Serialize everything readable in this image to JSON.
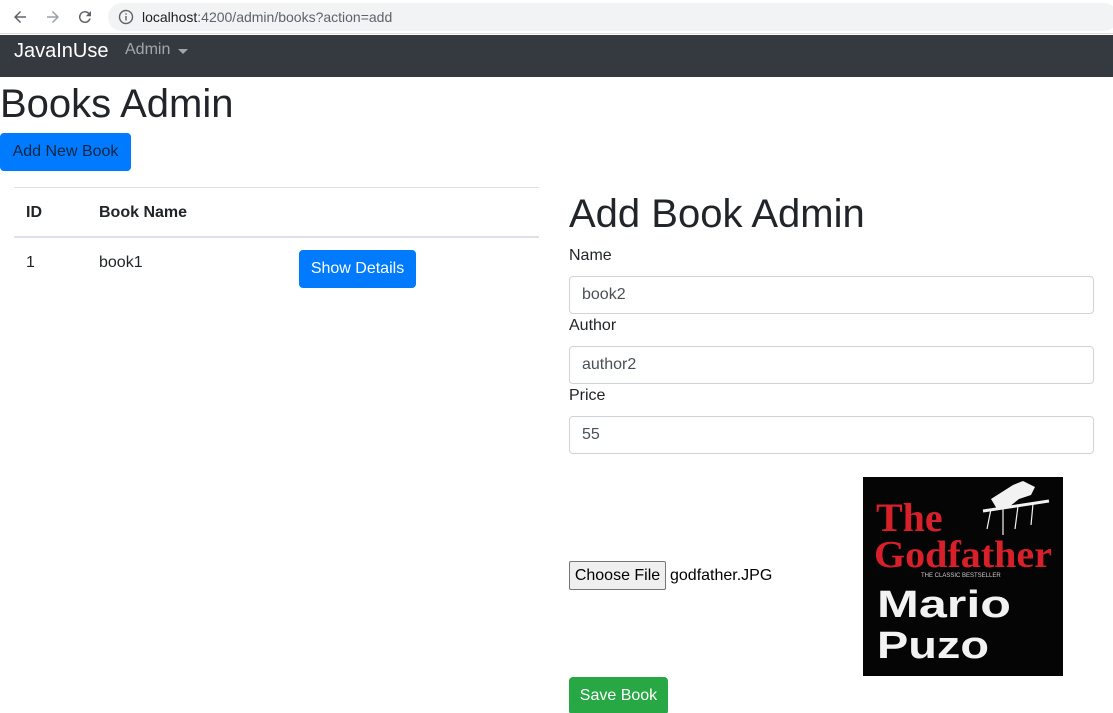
{
  "browser": {
    "url_host": "localhost",
    "url_path": ":4200/admin/books?action=add"
  },
  "navbar": {
    "brand": "JavaInUse",
    "admin_label": "Admin"
  },
  "page": {
    "title": "Books Admin",
    "add_new_label": "Add New Book"
  },
  "table": {
    "headers": [
      "ID",
      "Book Name"
    ],
    "rows": [
      {
        "id": "1",
        "name": "book1",
        "action_label": "Show Details"
      }
    ]
  },
  "form": {
    "title": "Add Book Admin",
    "name_label": "Name",
    "name_value": "book2",
    "author_label": "Author",
    "author_value": "author2",
    "price_label": "Price",
    "price_value": "55",
    "choose_file_label": "Choose File",
    "file_name": "godfather.JPG",
    "save_label": "Save Book"
  },
  "cover": {
    "line1": "The",
    "line2": "Godfather",
    "tagline": "THE CLASSIC BESTSELLER",
    "author_line1": "Mario",
    "author_line2": "Puzo"
  },
  "colors": {
    "navbar_bg": "#343a40",
    "primary": "#007bff",
    "success": "#28a745",
    "cover_red": "#d8202a"
  }
}
